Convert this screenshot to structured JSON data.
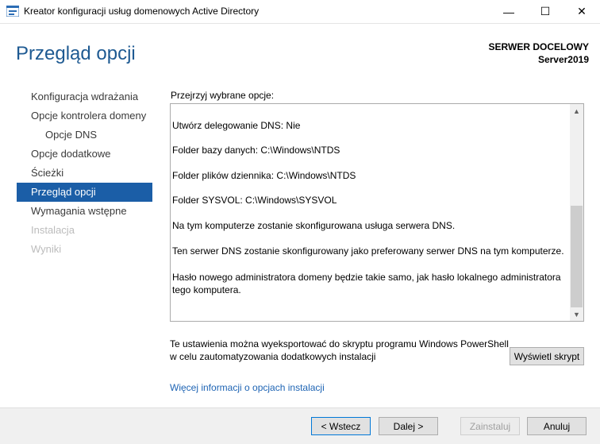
{
  "window": {
    "title": "Kreator konfiguracji usług domenowych Active Directory",
    "min_glyph": "—",
    "max_glyph": "☐",
    "close_glyph": "✕"
  },
  "header": {
    "title": "Przegląd opcji",
    "server_label": "SERWER DOCELOWY",
    "server_name": "Server2019"
  },
  "nav": {
    "items": [
      {
        "label": "Konfiguracja wdrażania",
        "state": "normal"
      },
      {
        "label": "Opcje kontrolera domeny",
        "state": "normal"
      },
      {
        "label": "Opcje DNS",
        "state": "normal"
      },
      {
        "label": "Opcje dodatkowe",
        "state": "normal"
      },
      {
        "label": "Ścieżki",
        "state": "normal"
      },
      {
        "label": "Przegląd opcji",
        "state": "active"
      },
      {
        "label": "Wymagania wstępne",
        "state": "normal"
      },
      {
        "label": "Instalacja",
        "state": "disabled"
      },
      {
        "label": "Wyniki",
        "state": "disabled"
      }
    ]
  },
  "content": {
    "label": "Przejrzyj wybrane opcje:",
    "review_lines": [
      "  Utwórz delegowanie DNS: Nie",
      "Folder bazy danych: C:\\Windows\\NTDS",
      "Folder plików dziennika: C:\\Windows\\NTDS",
      "Folder SYSVOL: C:\\Windows\\SYSVOL",
      "Na tym komputerze zostanie skonfigurowana usługa serwera DNS.",
      "Ten serwer DNS zostanie skonfigurowany jako preferowany serwer DNS na tym komputerze.",
      "Hasło nowego administratora domeny będzie takie samo, jak hasło lokalnego administratora",
      "tego komputera."
    ],
    "export_line1": "Te ustawienia można wyeksportować do skryptu programu Windows PowerShell",
    "export_line2": "w celu zautomatyzowania dodatkowych instalacji",
    "script_button": "Wyświetl skrypt",
    "more_link": "Więcej informacji o opcjach instalacji"
  },
  "footer": {
    "back": "< Wstecz",
    "next": "Dalej >",
    "install": "Zainstaluj",
    "cancel": "Anuluj"
  },
  "colors": {
    "accent": "#1b5ea7",
    "title": "#1e5a92",
    "link": "#1e64b4"
  }
}
